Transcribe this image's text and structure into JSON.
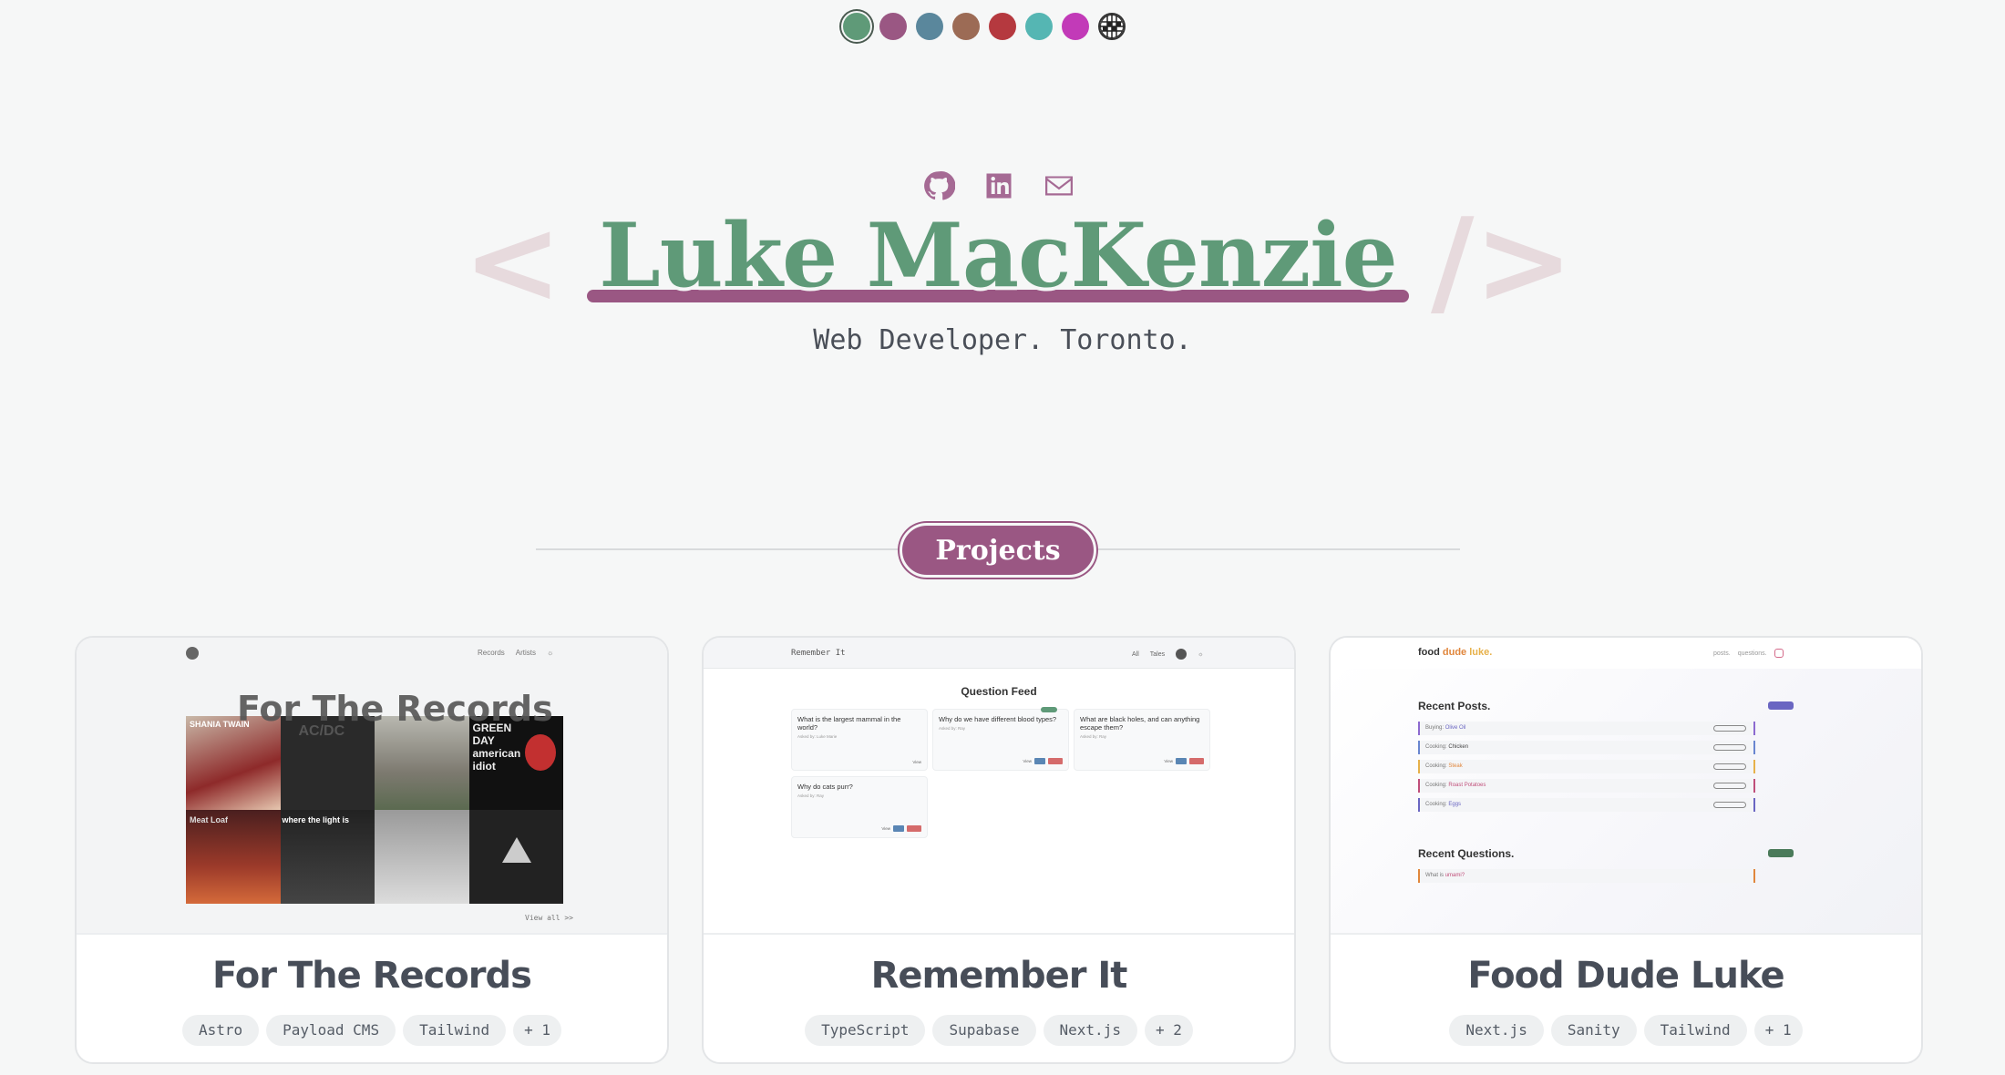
{
  "theme_picker": {
    "swatches": [
      {
        "name": "green",
        "color": "#5f9a78",
        "active": true
      },
      {
        "name": "plum",
        "color": "#9a5783"
      },
      {
        "name": "steel-blue",
        "color": "#5a879c"
      },
      {
        "name": "brown",
        "color": "#9c6b55"
      },
      {
        "name": "red",
        "color": "#b5393f"
      },
      {
        "name": "teal",
        "color": "#55b6b3"
      },
      {
        "name": "magenta",
        "color": "#c23ab8"
      },
      {
        "name": "disco-ball",
        "icon": "disco-ball-icon"
      }
    ]
  },
  "socials": [
    {
      "icon": "github-icon"
    },
    {
      "icon": "linkedin-icon"
    },
    {
      "icon": "email-icon"
    }
  ],
  "hero": {
    "bracket_open": "<",
    "bracket_close": "/>",
    "name": "Luke MacKenzie",
    "tagline": "Web Developer. Toronto."
  },
  "section": {
    "title": "Projects"
  },
  "projects": [
    {
      "title": "For The Records",
      "tags": [
        "Astro",
        "Payload CMS",
        "Tailwind",
        "+ 1"
      ],
      "preview": {
        "nav": [
          "Records",
          "Artists"
        ],
        "headline": "For The Records",
        "view_all": "View all >>",
        "albums": [
          "SHANIA TWAIN",
          "AC/DC",
          "",
          "GREEN DAY american idiot",
          "Meat Loaf",
          "where the light is",
          "",
          ""
        ]
      }
    },
    {
      "title": "Remember It",
      "tags": [
        "TypeScript",
        "Supabase",
        "Next.js",
        "+ 2"
      ],
      "preview": {
        "brand": "Remember It",
        "nav": [
          "All",
          "Tales"
        ],
        "heading": "Question Feed",
        "questions": [
          {
            "q": "What is the largest mammal in the world?",
            "by": "Asked by: Luke Marie"
          },
          {
            "q": "Why do we have different blood types?",
            "by": "Asked by: Ray"
          },
          {
            "q": "What are black holes, and can anything escape them?",
            "by": "Asked by: Ray"
          },
          {
            "q": "Why do cats purr?",
            "by": "Asked by: Ray"
          }
        ],
        "view_label": "View"
      }
    },
    {
      "title": "Food Dude Luke",
      "tags": [
        "Next.js",
        "Sanity",
        "Tailwind",
        "+ 1"
      ],
      "preview": {
        "logo_food": "food ",
        "logo_dude": "dude ",
        "logo_luke": "luke.",
        "nav": [
          "posts.",
          "questions."
        ],
        "recent_posts": "Recent Posts.",
        "posts": [
          {
            "prefix": "Buying:",
            "item": "Olive Oil"
          },
          {
            "prefix": "Cooking:",
            "item": "Chicken"
          },
          {
            "prefix": "Cooking:",
            "item": "Steak"
          },
          {
            "prefix": "Cooking:",
            "item": "Roast Potatoes"
          },
          {
            "prefix": "Cooking:",
            "item": "Eggs"
          }
        ],
        "recent_questions": "Recent Questions.",
        "question": {
          "prefix": "What is",
          "item": "umami?"
        },
        "see_all": "see all"
      }
    }
  ]
}
